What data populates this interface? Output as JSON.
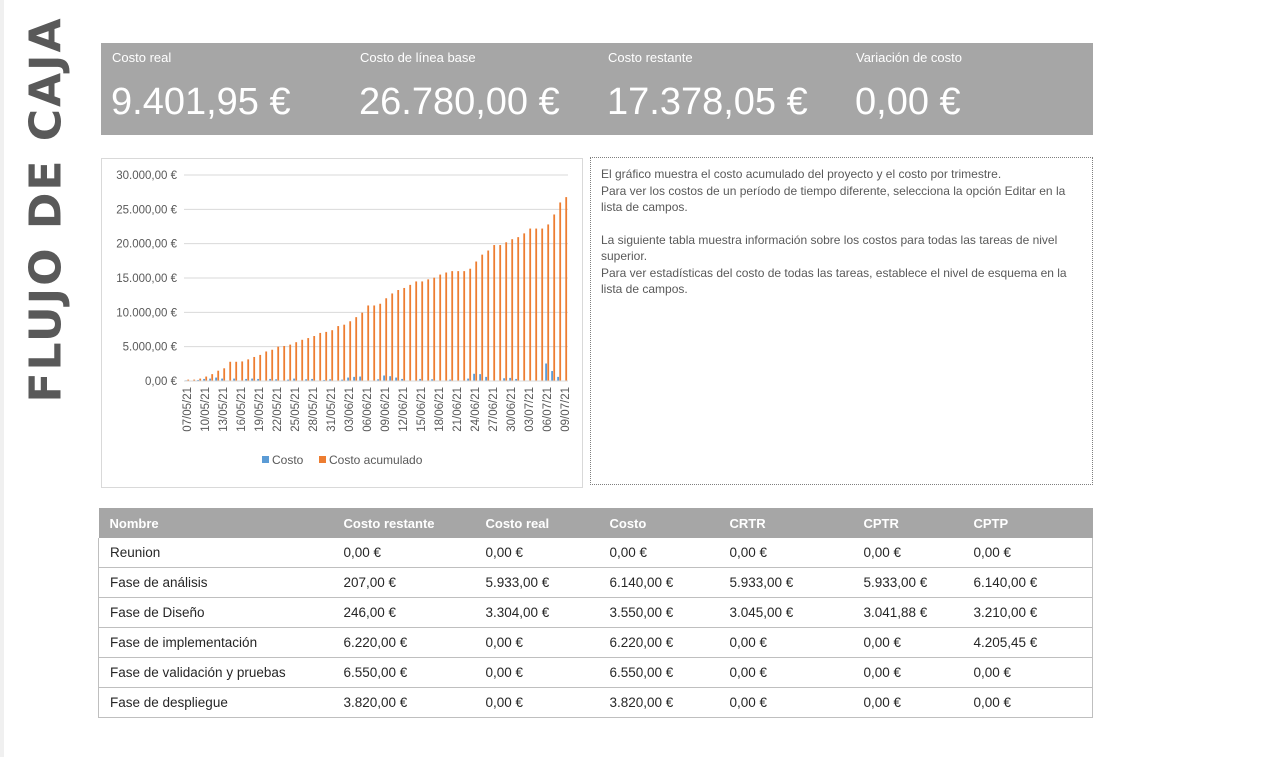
{
  "page_title": "FLUJO DE CAJA",
  "kpis": [
    {
      "label": "Costo real",
      "value": "9.401,95 €"
    },
    {
      "label": "Costo de línea base",
      "value": "26.780,00 €"
    },
    {
      "label": "Costo restante",
      "value": "17.378,05 €"
    },
    {
      "label": "Variación de costo",
      "value": "0,00 €"
    }
  ],
  "notes": [
    "El gráfico muestra el costo acumulado del proyecto y el costo por trimestre.",
    "Para ver los costos de un período de tiempo diferente, selecciona la opción Editar en la lista de campos.",
    "La siguiente tabla muestra información sobre los costos para todas las tareas de nivel superior.",
    "Para ver estadísticas del costo de todas las tareas, establece el nivel de esquema en la lista de campos."
  ],
  "table": {
    "headers": [
      "Nombre",
      "Costo restante",
      "Costo real",
      "Costo",
      "CRTR",
      "CPTR",
      "CPTP"
    ],
    "rows": [
      [
        "Reunion",
        "0,00 €",
        "0,00 €",
        "0,00 €",
        "0,00 €",
        "0,00 €",
        "0,00 €"
      ],
      [
        "Fase de análisis",
        "207,00 €",
        "5.933,00 €",
        "6.140,00 €",
        "5.933,00 €",
        "5.933,00 €",
        "6.140,00 €"
      ],
      [
        "Fase de Diseño",
        "246,00 €",
        "3.304,00 €",
        "3.550,00 €",
        "3.045,00 €",
        "3.041,88 €",
        "3.210,00 €"
      ],
      [
        "Fase de implementación",
        "6.220,00 €",
        "0,00 €",
        "6.220,00 €",
        "0,00 €",
        "0,00 €",
        "4.205,45 €"
      ],
      [
        "Fase de validación y pruebas",
        "6.550,00 €",
        "0,00 €",
        "6.550,00 €",
        "0,00 €",
        "0,00 €",
        "0,00 €"
      ],
      [
        "Fase de despliegue",
        "3.820,00 €",
        "0,00 €",
        "3.820,00 €",
        "0,00 €",
        "0,00 €",
        "0,00 €"
      ]
    ]
  },
  "colors": {
    "costo": "#5b9bd5",
    "costo_acumulado": "#ed7d31",
    "band": "#a6a6a6"
  },
  "chart_data": {
    "type": "bar",
    "title": "",
    "xlabel": "",
    "ylabel": "",
    "ylim": [
      0,
      30000
    ],
    "yticks": [
      "0,00 €",
      "5.000,00 €",
      "10.000,00 €",
      "15.000,00 €",
      "20.000,00 €",
      "25.000,00 €",
      "30.000,00 €"
    ],
    "grid": true,
    "legend_position": "bottom",
    "categories": [
      "07/05/21",
      "08/05/21",
      "09/05/21",
      "10/05/21",
      "11/05/21",
      "12/05/21",
      "13/05/21",
      "14/05/21",
      "15/05/21",
      "16/05/21",
      "17/05/21",
      "18/05/21",
      "19/05/21",
      "20/05/21",
      "21/05/21",
      "22/05/21",
      "23/05/21",
      "24/05/21",
      "25/05/21",
      "26/05/21",
      "27/05/21",
      "28/05/21",
      "29/05/21",
      "30/05/21",
      "31/05/21",
      "01/06/21",
      "02/06/21",
      "03/06/21",
      "04/06/21",
      "05/06/21",
      "06/06/21",
      "07/06/21",
      "08/06/21",
      "09/06/21",
      "10/06/21",
      "11/06/21",
      "12/06/21",
      "13/06/21",
      "14/06/21",
      "15/06/21",
      "16/06/21",
      "17/06/21",
      "18/06/21",
      "19/06/21",
      "20/06/21",
      "21/06/21",
      "22/06/21",
      "23/06/21",
      "24/06/21",
      "25/06/21",
      "26/06/21",
      "27/06/21",
      "28/06/21",
      "29/06/21",
      "30/06/21",
      "01/07/21",
      "02/07/21",
      "03/07/21",
      "04/07/21",
      "05/07/21",
      "06/07/21",
      "07/07/21",
      "08/07/21",
      "09/07/21"
    ],
    "tick_labels": [
      "07/05/21",
      "10/05/21",
      "13/05/21",
      "16/05/21",
      "19/05/21",
      "22/05/21",
      "25/05/21",
      "28/05/21",
      "31/05/21",
      "03/06/21",
      "06/06/21",
      "09/06/21",
      "12/06/21",
      "15/06/21",
      "18/06/21",
      "21/06/21",
      "24/06/21",
      "27/06/21",
      "30/06/21",
      "03/07/21",
      "06/07/21",
      "09/07/21"
    ],
    "series": [
      {
        "name": "Costo",
        "values": [
          100,
          0,
          150,
          300,
          350,
          500,
          350,
          0,
          350,
          0,
          300,
          350,
          300,
          0,
          300,
          250,
          0,
          200,
          350,
          0,
          250,
          300,
          0,
          150,
          250,
          0,
          200,
          500,
          600,
          650,
          0,
          0,
          250,
          800,
          700,
          500,
          300,
          0,
          0,
          300,
          0,
          250,
          0,
          0,
          200,
          0,
          0,
          350,
          1050,
          1000,
          600,
          0,
          0,
          400,
          450,
          300,
          0,
          0,
          0,
          0,
          2550,
          1450,
          600,
          0
        ]
      },
      {
        "name": "Costo acumulado",
        "values": [
          200,
          200,
          350,
          650,
          1000,
          1500,
          1850,
          2800,
          2800,
          2850,
          3150,
          3500,
          3800,
          4300,
          4550,
          5000,
          5100,
          5300,
          5650,
          6000,
          6250,
          6550,
          7000,
          7150,
          7400,
          8000,
          8200,
          8700,
          9300,
          9950,
          11000,
          11000,
          11250,
          12050,
          12750,
          13250,
          13550,
          14000,
          14500,
          14500,
          14800,
          15050,
          15500,
          15800,
          16000,
          16000,
          16000,
          16350,
          17400,
          18400,
          19000,
          19800,
          19800,
          20200,
          20650,
          20950,
          21500,
          22200,
          22200,
          22200,
          22800,
          24250,
          26000,
          26780
        ]
      }
    ]
  }
}
